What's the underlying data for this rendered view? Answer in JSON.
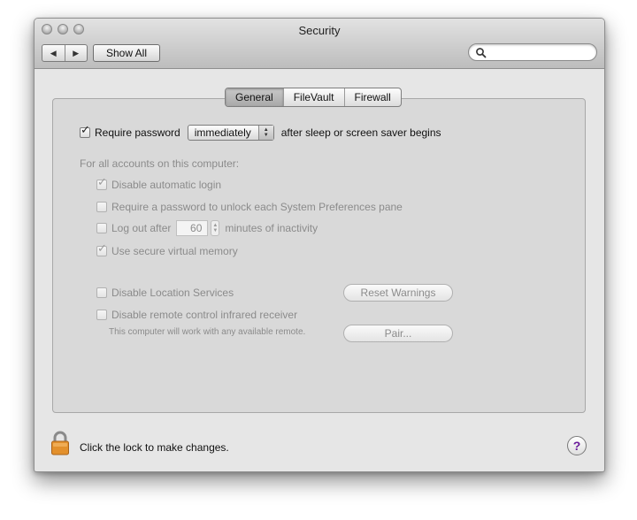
{
  "window": {
    "title": "Security"
  },
  "toolbar": {
    "back_glyph": "◀",
    "forward_glyph": "▶",
    "show_all_label": "Show All",
    "search_placeholder": ""
  },
  "tabs": [
    {
      "label": "General",
      "active": true
    },
    {
      "label": "FileVault",
      "active": false
    },
    {
      "label": "Firewall",
      "active": false
    }
  ],
  "general": {
    "require_password": {
      "checked": true,
      "label": "Require password",
      "popup_value": "immediately",
      "suffix": "after sleep or screen saver begins"
    },
    "all_accounts_heading": "For all accounts on this computer:",
    "disable_auto_login": {
      "checked": true,
      "label": "Disable automatic login"
    },
    "require_pw_prefs": {
      "checked": false,
      "label": "Require a password to unlock each System Preferences pane"
    },
    "logout": {
      "checked": false,
      "label": "Log out after",
      "minutes": "60",
      "suffix": "minutes of inactivity"
    },
    "secure_vm": {
      "checked": true,
      "label": "Use secure virtual memory"
    },
    "disable_location": {
      "checked": false,
      "label": "Disable Location Services"
    },
    "reset_warnings_label": "Reset Warnings",
    "disable_ir": {
      "checked": false,
      "label": "Disable remote control infrared receiver"
    },
    "ir_note": "This computer will work with any available remote.",
    "pair_label": "Pair..."
  },
  "footer": {
    "lock_text": "Click the lock to make changes.",
    "help_glyph": "?"
  },
  "colors": {
    "lock": "#e3902c",
    "help_glyph": "#6a1b9a"
  }
}
